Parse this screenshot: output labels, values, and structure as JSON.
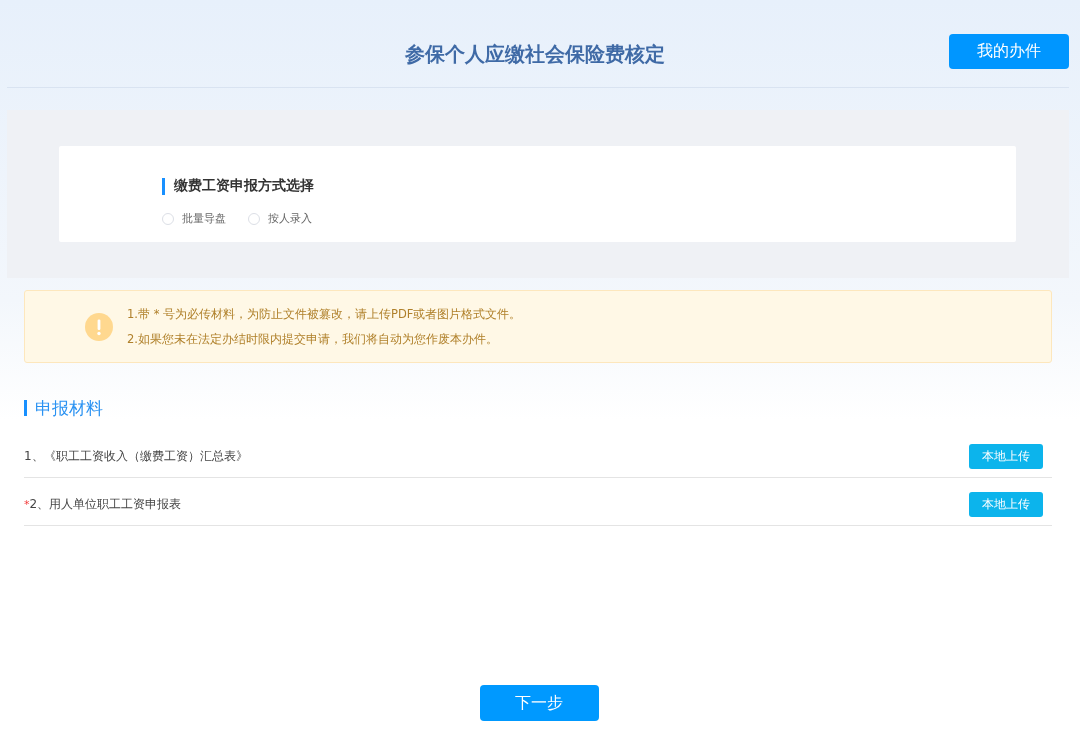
{
  "header": {
    "title": "参保个人应缴社会保险费核定",
    "my_cases_button": "我的办件"
  },
  "declaration_method": {
    "title": "缴费工资申报方式选择",
    "options": [
      {
        "label": "批量导盘",
        "selected": false
      },
      {
        "label": "按人录入",
        "selected": false
      }
    ]
  },
  "notice": {
    "lines": [
      "1.带 * 号为必传材料，为防止文件被篡改，请上传PDF或者图片格式文件。",
      "2.如果您未在法定办结时限内提交申请，我们将自动为您作废本办件。"
    ]
  },
  "materials": {
    "title": "申报材料",
    "items": [
      {
        "label": "1、《职工工资收入（缴费工资）汇总表》",
        "upload_button": "本地上传"
      },
      {
        "required_mark": "*",
        "label": "2、用人单位职工工资申报表",
        "upload_button": "本地上传"
      }
    ]
  },
  "next_button": "下一步"
}
